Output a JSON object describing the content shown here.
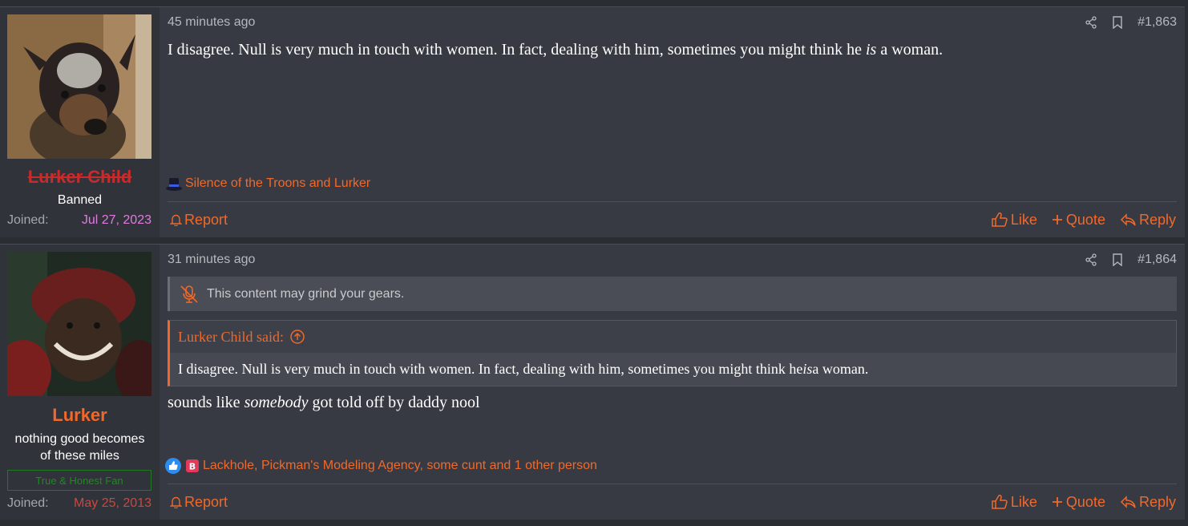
{
  "posts": [
    {
      "username": "Lurker Child",
      "user_title": "Banned",
      "joined_label": "Joined:",
      "joined_date": "Jul 27, 2023",
      "time": "45 minutes ago",
      "post_number": "#1,863",
      "body_pre": "I disagree. Null is very much in touch with women. In fact, dealing with him, sometimes you might think he ",
      "body_em": "is",
      "body_post": " a woman.",
      "reactions": "Silence of the Troons and Lurker",
      "actions": {
        "report": "Report",
        "like": "Like",
        "quote": "Quote",
        "reply": "Reply"
      }
    },
    {
      "username": "Lurker",
      "user_title_line1": "nothing good becomes",
      "user_title_line2": "of these miles",
      "badge": "True & Honest Fan",
      "joined_label": "Joined:",
      "joined_date": "May 25, 2013",
      "time": "31 minutes ago",
      "post_number": "#1,864",
      "spoiler": "This content may grind your gears.",
      "quote_author": "Lurker Child said:",
      "quote_pre": "I disagree. Null is very much in touch with women. In fact, dealing with him, sometimes you might think he ",
      "quote_em": "is",
      "quote_post": " a woman.",
      "body_pre": "sounds like ",
      "body_em": "somebody",
      "body_post": " got told off by daddy nool",
      "reactions": "Lackhole, Pickman's Modeling Agency, some cunt and 1 other person",
      "actions": {
        "report": "Report",
        "like": "Like",
        "quote": "Quote",
        "reply": "Reply"
      }
    }
  ],
  "colors": {
    "accent": "#f0692a",
    "banned_name": "#c92a2a",
    "joined1": "#e07ae0",
    "joined2": "#d0463c"
  }
}
